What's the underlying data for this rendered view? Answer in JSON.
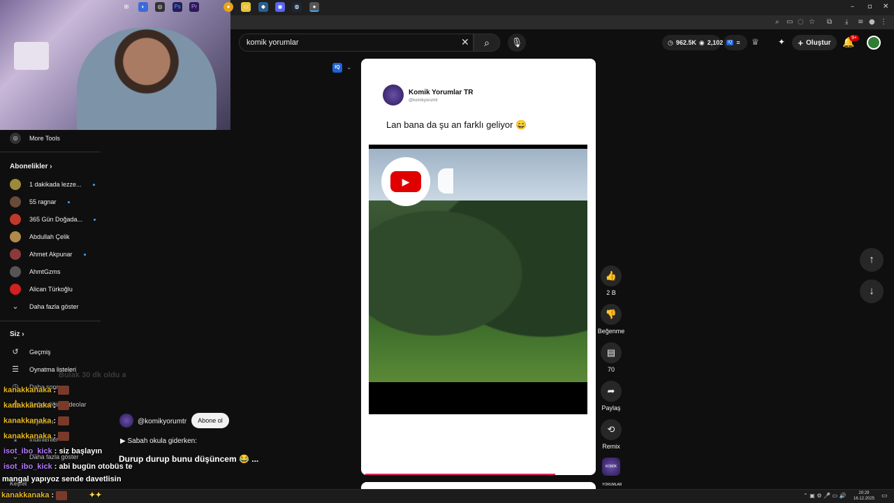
{
  "window": {
    "minimize": "–",
    "maximize": "▫",
    "close": "✕"
  },
  "search": {
    "value": "komik yorumlar"
  },
  "header": {
    "stat1": "962.5K",
    "stat2": "2,102",
    "create_label": "Oluştur",
    "notif_badge": "9+"
  },
  "sidebar": {
    "more_tools": "More Tools",
    "subs_heading": "Abonelikler",
    "subs": [
      {
        "label": "1 dakikada lezze...",
        "new": true,
        "color": "#9c8a3a"
      },
      {
        "label": "55 ragnar",
        "new": true,
        "color": "#6a4a3a"
      },
      {
        "label": "365 Gün Doğada...",
        "new": true,
        "color": "#c0392b"
      },
      {
        "label": "Abdullah Çelik",
        "new": false,
        "color": "#b08a4a"
      },
      {
        "label": "Ahmet Akpunar",
        "new": true,
        "color": "#8a3a3a"
      },
      {
        "label": "AhmtGzms",
        "new": false,
        "color": "#555"
      },
      {
        "label": "Alican Türkoğlu",
        "new": false,
        "color": "#d02020"
      }
    ],
    "show_more": "Daha fazla göster",
    "you_heading": "Siz",
    "you": [
      "Geçmiş",
      "Oynatma listeleri",
      "Daha sonra",
      "Beğendiğim videolar",
      "Kliplerim",
      "İndirilenler"
    ],
    "show_more2": "Daha fazla göster",
    "explore": "Keşfet"
  },
  "post": {
    "channel": "Komik Yorumlar TR",
    "handle": "@komikyorumtr",
    "text": "Lan bana da şu an farklı geliyor 😄"
  },
  "actions": {
    "likes": "2 B",
    "dislike": "Beğenme",
    "comments": "70",
    "share": "Paylaş",
    "remix": "Remix",
    "remix_thumb": "KOMİK YORUMLAR"
  },
  "channel_info": {
    "handle": "@komikyorumtr",
    "subscribe": "Abone ol",
    "desc": "▶ Sabah okula giderken:",
    "title": "Durup durup bunu düşüncem 😂 ...",
    "ghost": "Bulak 30 dk oldu a"
  },
  "chat": [
    {
      "user": "kanakkanaka",
      "msg": "",
      "emote": true,
      "cls": "u-gold"
    },
    {
      "user": "kanakkanaka",
      "msg": "",
      "emote": true,
      "cls": "u-gold"
    },
    {
      "user": "kanakkanaka",
      "msg": "",
      "emote": true,
      "cls": "u-gold"
    },
    {
      "user": "kanakkanaka",
      "msg": "",
      "emote": true,
      "cls": "u-gold"
    },
    {
      "user": "isot_ibo_kick",
      "msg": "siz başlayın",
      "emote": false,
      "cls": "u-purple"
    },
    {
      "user": "isot_ibo_kick",
      "msg": "abi bugün otobüs te",
      "emote": false,
      "cls": "u-purple"
    }
  ],
  "chat_tail": "mangal yapıyoz sende davetlisin",
  "chat_last": {
    "user": "kanakkanaka",
    "extra": "✦✦"
  },
  "taskbar": {
    "clock_time": "20:29",
    "clock_date": "16.12.2025"
  }
}
